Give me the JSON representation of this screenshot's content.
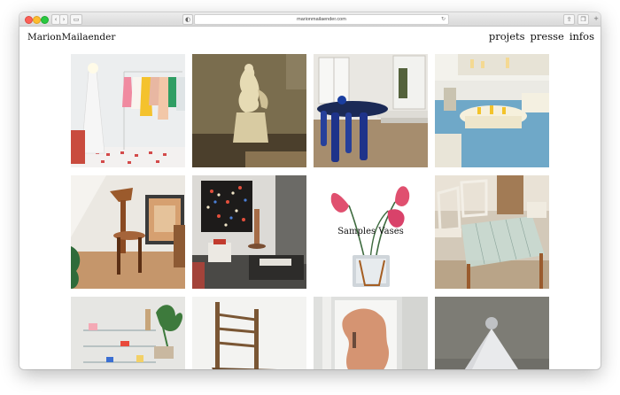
{
  "browser": {
    "url": "marionmailaender.com",
    "icons": [
      "back-icon",
      "forward-icon",
      "sidebar-icon",
      "shield-icon",
      "reload-icon",
      "share-icon",
      "tabs-icon",
      "new-tab-icon"
    ]
  },
  "header": {
    "brand": "MarionMailaender",
    "nav": [
      "projets",
      "presse",
      "infos"
    ]
  },
  "grid": {
    "featured_caption": "Samples Vases",
    "tiles": [
      "Clothing rack with lamp",
      "Sculpture statue",
      "Blue table room",
      "Blue shop counter",
      "Wooden chair and frame",
      "Textile artwork room",
      "Samples Vases",
      "Glass table chairs",
      "Glass shelving",
      "Wooden chair",
      "Brown shape door",
      "Stone pyramid object"
    ]
  },
  "colors": {
    "text": "#111111",
    "background": "#ffffff"
  }
}
